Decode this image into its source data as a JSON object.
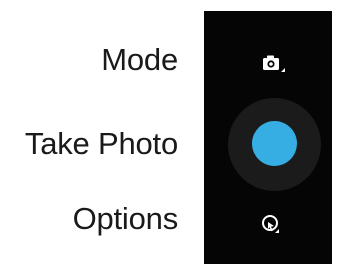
{
  "labels": {
    "mode": "Mode",
    "take_photo": "Take Photo",
    "options": "Options"
  },
  "camera_panel": {
    "background": "#050505",
    "shutter_color": "#36aee4",
    "icons": {
      "mode": "camera-icon",
      "shutter": "shutter-circle-icon",
      "options": "options-icon"
    }
  }
}
